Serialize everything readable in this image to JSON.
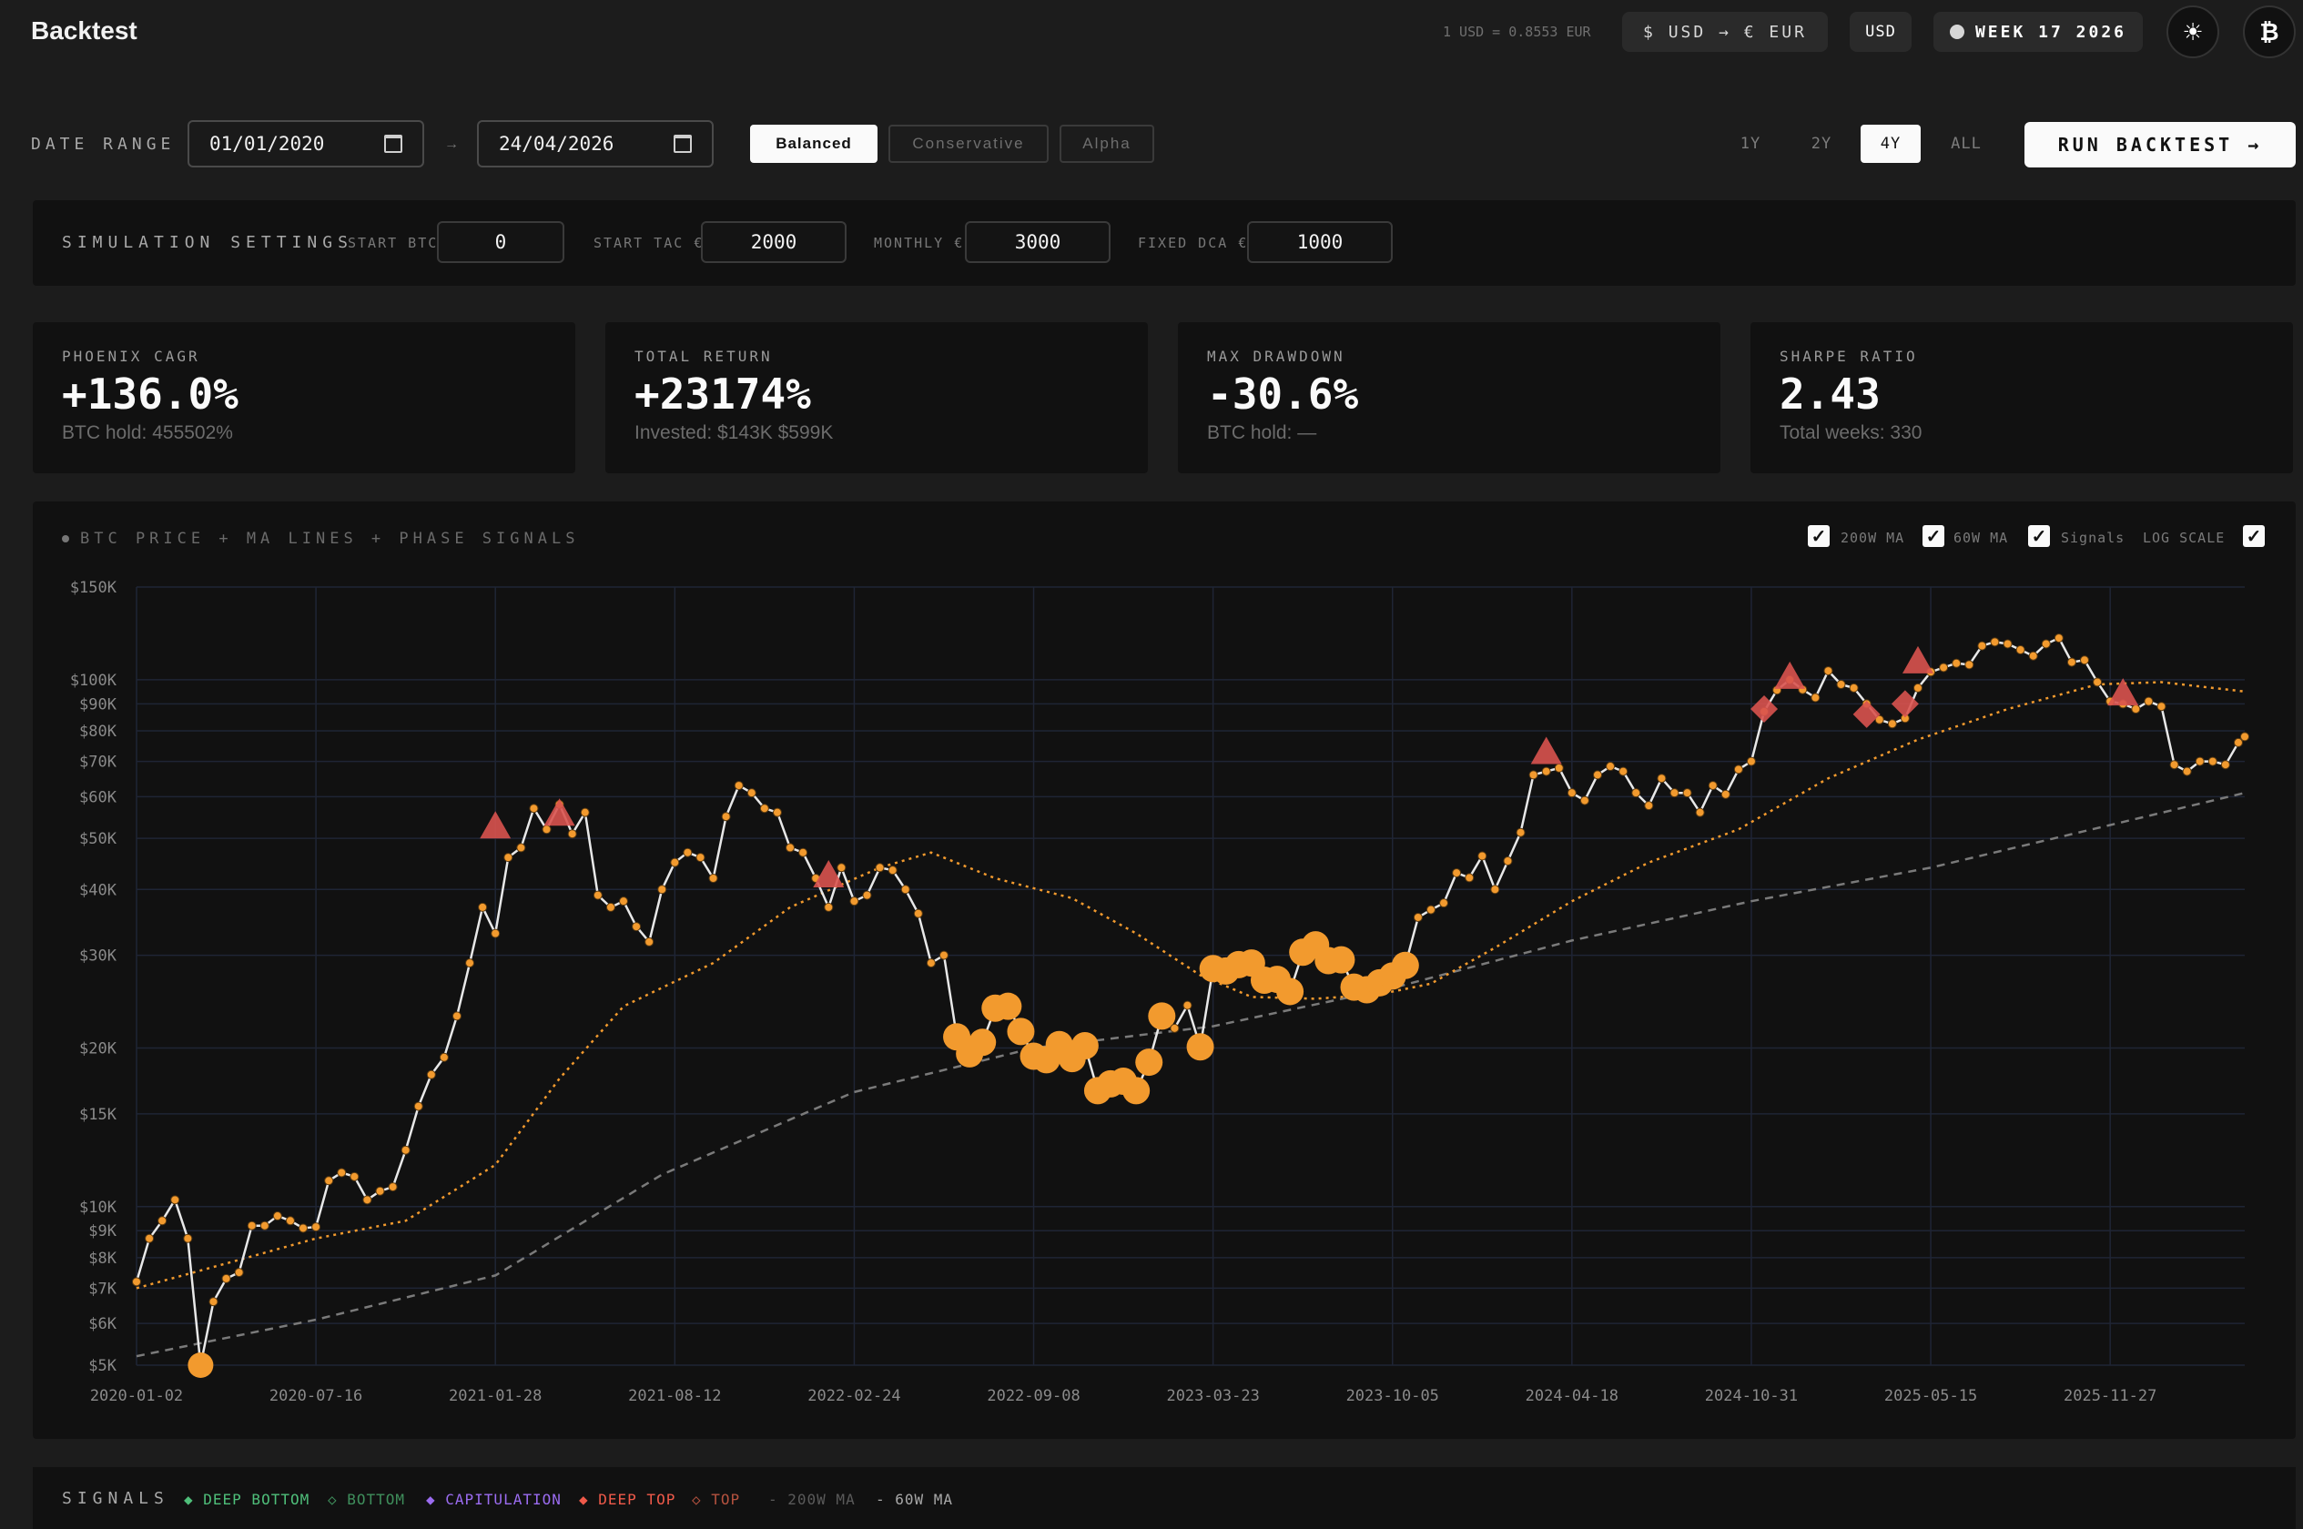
{
  "header": {
    "title": "Backtest",
    "fx_rate": "1 USD = 0.8553 EUR",
    "convert_label": "$ USD → € EUR",
    "currency": "USD",
    "week": "WEEK 17 2026",
    "theme_icon": "sun-icon",
    "brand_icon": "bitcoin-icon"
  },
  "date_range": {
    "label": "DATE RANGE",
    "from": "01/01/2020",
    "separator": "→",
    "to": "24/04/2026"
  },
  "strategies": {
    "selected": "Balanced",
    "items": [
      "Balanced",
      "Conservative",
      "Alpha"
    ]
  },
  "periods": {
    "selected": "4Y",
    "items": [
      "1Y",
      "2Y",
      "4Y",
      "ALL"
    ]
  },
  "run_button": "RUN BACKTEST →",
  "simulation": {
    "title": "SIMULATION SETTINGS",
    "start_btc_label": "START BTC",
    "start_btc": "0",
    "start_tac_label": "START TAC €",
    "start_tac": "2000",
    "monthly_label": "MONTHLY €",
    "monthly": "3000",
    "fixed_dca_label": "FIXED DCA €",
    "fixed_dca": "1000"
  },
  "stats": [
    {
      "label": "PHOENIX CAGR",
      "value": "+136.0%",
      "sub": "BTC hold: 455502%"
    },
    {
      "label": "TOTAL RETURN",
      "value": "+23174%",
      "sub": "Invested: $143K $599K"
    },
    {
      "label": "MAX DRAWDOWN",
      "value": "-30.6%",
      "sub": "BTC hold: —"
    },
    {
      "label": "SHARPE RATIO",
      "value": "2.43",
      "sub": "Total weeks: 330"
    }
  ],
  "chart_panel": {
    "title": "BTC PRICE + MA LINES + PHASE SIGNALS",
    "toggles": {
      "ma200": "200W MA",
      "ma60": "60W MA",
      "signals": "Signals",
      "log_scale": "LOG SCALE"
    },
    "checked": {
      "ma200": true,
      "ma60": true,
      "signals": true,
      "log_scale": true
    }
  },
  "legend": {
    "title": "SIGNALS",
    "items": [
      {
        "label": "◆ DEEP BOTTOM",
        "color": "#4fbf7a"
      },
      {
        "label": "◇ BOTTOM",
        "color": "#3f8f5c"
      },
      {
        "label": "◆ CAPITULATION",
        "color": "#9b6cf0"
      },
      {
        "label": "◆ DEEP TOP",
        "color": "#f05a4a"
      },
      {
        "label": "◇ TOP",
        "color": "#b5523f"
      },
      {
        "label": "- 200W MA",
        "color": "#5a5a5a"
      },
      {
        "label": "- 60W MA",
        "color": "#a8a8a8"
      }
    ]
  },
  "colors": {
    "accent": "#f29a2e",
    "top_signal": "#d9534f",
    "price_line": "#e8e8e8",
    "ma200": "#7a7a7a",
    "ma60": "#f29a2e"
  },
  "chart_data": {
    "type": "line",
    "title": "BTC PRICE + MA LINES + PHASE SIGNALS",
    "y_scale": "log",
    "ylim": [
      5000,
      150000
    ],
    "y_ticks": [
      {
        "v": 150000,
        "label": "$150K"
      },
      {
        "v": 100000,
        "label": "$100K"
      },
      {
        "v": 90000,
        "label": "$90K"
      },
      {
        "v": 80000,
        "label": "$80K"
      },
      {
        "v": 70000,
        "label": "$70K"
      },
      {
        "v": 60000,
        "label": "$60K"
      },
      {
        "v": 50000,
        "label": "$50K"
      },
      {
        "v": 40000,
        "label": "$40K"
      },
      {
        "v": 30000,
        "label": "$30K"
      },
      {
        "v": 20000,
        "label": "$20K"
      },
      {
        "v": 15000,
        "label": "$15K"
      },
      {
        "v": 10000,
        "label": "$10K"
      },
      {
        "v": 9000,
        "label": "$9K"
      },
      {
        "v": 8000,
        "label": "$8K"
      },
      {
        "v": 7000,
        "label": "$7K"
      },
      {
        "v": 6000,
        "label": "$6K"
      },
      {
        "v": 5000,
        "label": "$5K"
      }
    ],
    "x_ticks": [
      "2020-01-02",
      "2020-07-16",
      "2021-01-28",
      "2021-08-12",
      "2022-02-24",
      "2022-09-08",
      "2023-03-23",
      "2023-10-05",
      "2024-04-18",
      "2024-10-31",
      "2025-05-15",
      "2025-11-27"
    ],
    "xlim": [
      "2020-01-02",
      "2026-04-23"
    ],
    "grid": true,
    "series": [
      {
        "name": "BTC price",
        "points": [
          [
            "2020-01-02",
            7200
          ],
          [
            "2020-01-16",
            8700
          ],
          [
            "2020-01-30",
            9400
          ],
          [
            "2020-02-13",
            10300
          ],
          [
            "2020-02-27",
            8700
          ],
          [
            "2020-03-12",
            5000
          ],
          [
            "2020-03-26",
            6600
          ],
          [
            "2020-04-09",
            7300
          ],
          [
            "2020-04-23",
            7500
          ],
          [
            "2020-05-07",
            9200
          ],
          [
            "2020-05-21",
            9200
          ],
          [
            "2020-06-04",
            9600
          ],
          [
            "2020-06-18",
            9400
          ],
          [
            "2020-07-02",
            9100
          ],
          [
            "2020-07-16",
            9150
          ],
          [
            "2020-07-30",
            11200
          ],
          [
            "2020-08-13",
            11600
          ],
          [
            "2020-08-27",
            11400
          ],
          [
            "2020-09-10",
            10300
          ],
          [
            "2020-09-24",
            10700
          ],
          [
            "2020-10-08",
            10900
          ],
          [
            "2020-10-22",
            12800
          ],
          [
            "2020-11-05",
            15500
          ],
          [
            "2020-11-19",
            17800
          ],
          [
            "2020-12-03",
            19200
          ],
          [
            "2020-12-17",
            23000
          ],
          [
            "2020-12-31",
            29000
          ],
          [
            "2021-01-14",
            37000
          ],
          [
            "2021-01-28",
            33000
          ],
          [
            "2021-02-11",
            46000
          ],
          [
            "2021-02-25",
            48000
          ],
          [
            "2021-03-11",
            57000
          ],
          [
            "2021-03-25",
            52000
          ],
          [
            "2021-04-08",
            58000
          ],
          [
            "2021-04-22",
            51000
          ],
          [
            "2021-05-06",
            56000
          ],
          [
            "2021-05-20",
            39000
          ],
          [
            "2021-06-03",
            37000
          ],
          [
            "2021-06-17",
            38000
          ],
          [
            "2021-07-01",
            34000
          ],
          [
            "2021-07-15",
            31800
          ],
          [
            "2021-07-29",
            40000
          ],
          [
            "2021-08-12",
            45000
          ],
          [
            "2021-08-26",
            47000
          ],
          [
            "2021-09-09",
            46000
          ],
          [
            "2021-09-23",
            42000
          ],
          [
            "2021-10-07",
            55000
          ],
          [
            "2021-10-21",
            63000
          ],
          [
            "2021-11-04",
            61000
          ],
          [
            "2021-11-18",
            57000
          ],
          [
            "2021-12-02",
            56000
          ],
          [
            "2021-12-16",
            48000
          ],
          [
            "2021-12-30",
            47000
          ],
          [
            "2022-01-13",
            42000
          ],
          [
            "2022-01-27",
            37000
          ],
          [
            "2022-02-10",
            44000
          ],
          [
            "2022-02-24",
            38000
          ],
          [
            "2022-03-10",
            39000
          ],
          [
            "2022-03-24",
            44000
          ],
          [
            "2022-04-07",
            43500
          ],
          [
            "2022-04-21",
            40000
          ],
          [
            "2022-05-05",
            36000
          ],
          [
            "2022-05-19",
            29000
          ],
          [
            "2022-06-02",
            30000
          ],
          [
            "2022-06-16",
            21000
          ],
          [
            "2022-06-30",
            19500
          ],
          [
            "2022-07-14",
            20500
          ],
          [
            "2022-07-28",
            23800
          ],
          [
            "2022-08-11",
            24000
          ],
          [
            "2022-08-25",
            21500
          ],
          [
            "2022-09-08",
            19300
          ],
          [
            "2022-09-22",
            19000
          ],
          [
            "2022-10-06",
            20300
          ],
          [
            "2022-10-20",
            19100
          ],
          [
            "2022-11-03",
            20200
          ],
          [
            "2022-11-17",
            16600
          ],
          [
            "2022-12-01",
            17100
          ],
          [
            "2022-12-15",
            17300
          ],
          [
            "2022-12-29",
            16600
          ],
          [
            "2023-01-12",
            18800
          ],
          [
            "2023-01-26",
            23000
          ],
          [
            "2023-02-09",
            21800
          ],
          [
            "2023-02-23",
            24100
          ],
          [
            "2023-03-09",
            20100
          ],
          [
            "2023-03-23",
            28300
          ],
          [
            "2023-04-06",
            28000
          ],
          [
            "2023-04-20",
            28800
          ],
          [
            "2023-05-04",
            29000
          ],
          [
            "2023-05-18",
            26900
          ],
          [
            "2023-06-01",
            27000
          ],
          [
            "2023-06-15",
            25600
          ],
          [
            "2023-06-29",
            30400
          ],
          [
            "2023-07-13",
            31400
          ],
          [
            "2023-07-27",
            29300
          ],
          [
            "2023-08-10",
            29400
          ],
          [
            "2023-08-24",
            26100
          ],
          [
            "2023-09-07",
            25800
          ],
          [
            "2023-09-21",
            26600
          ],
          [
            "2023-10-05",
            27400
          ],
          [
            "2023-10-19",
            28700
          ],
          [
            "2023-11-02",
            35400
          ],
          [
            "2023-11-16",
            36600
          ],
          [
            "2023-11-30",
            37700
          ],
          [
            "2023-12-14",
            43000
          ],
          [
            "2023-12-28",
            42100
          ],
          [
            "2024-01-11",
            46300
          ],
          [
            "2024-01-25",
            40000
          ],
          [
            "2024-02-08",
            45300
          ],
          [
            "2024-02-22",
            51300
          ],
          [
            "2024-03-07",
            66000
          ],
          [
            "2024-03-21",
            67000
          ],
          [
            "2024-04-04",
            68000
          ],
          [
            "2024-04-18",
            61000
          ],
          [
            "2024-05-02",
            59000
          ],
          [
            "2024-05-16",
            66000
          ],
          [
            "2024-05-30",
            68500
          ],
          [
            "2024-06-13",
            67000
          ],
          [
            "2024-06-27",
            61000
          ],
          [
            "2024-07-11",
            57700
          ],
          [
            "2024-07-25",
            65000
          ],
          [
            "2024-08-08",
            61000
          ],
          [
            "2024-08-22",
            61000
          ],
          [
            "2024-09-05",
            56000
          ],
          [
            "2024-09-19",
            63000
          ],
          [
            "2024-10-03",
            60600
          ],
          [
            "2024-10-17",
            67600
          ],
          [
            "2024-10-31",
            70000
          ],
          [
            "2024-11-14",
            87000
          ],
          [
            "2024-11-28",
            95600
          ],
          [
            "2024-12-12",
            100000
          ],
          [
            "2024-12-26",
            95800
          ],
          [
            "2025-01-09",
            92500
          ],
          [
            "2025-01-23",
            104000
          ],
          [
            "2025-02-06",
            98000
          ],
          [
            "2025-02-20",
            96500
          ],
          [
            "2025-03-06",
            90000
          ],
          [
            "2025-03-20",
            84000
          ],
          [
            "2025-04-03",
            82500
          ],
          [
            "2025-04-17",
            84500
          ],
          [
            "2025-05-01",
            96500
          ],
          [
            "2025-05-15",
            103500
          ],
          [
            "2025-05-29",
            105500
          ],
          [
            "2025-06-12",
            107500
          ],
          [
            "2025-06-26",
            106800
          ],
          [
            "2025-07-10",
            116000
          ],
          [
            "2025-07-24",
            118000
          ],
          [
            "2025-08-07",
            117000
          ],
          [
            "2025-08-21",
            114000
          ],
          [
            "2025-09-04",
            111000
          ],
          [
            "2025-09-18",
            117000
          ],
          [
            "2025-10-02",
            120000
          ],
          [
            "2025-10-16",
            108000
          ],
          [
            "2025-10-30",
            109000
          ],
          [
            "2025-11-13",
            99000
          ],
          [
            "2025-11-27",
            91000
          ],
          [
            "2025-12-11",
            90000
          ],
          [
            "2025-12-25",
            88000
          ],
          [
            "2026-01-08",
            91000
          ],
          [
            "2026-01-22",
            89000
          ],
          [
            "2026-02-05",
            69000
          ],
          [
            "2026-02-19",
            67000
          ],
          [
            "2026-03-05",
            70000
          ],
          [
            "2026-03-19",
            70000
          ],
          [
            "2026-04-02",
            69000
          ],
          [
            "2026-04-16",
            76000
          ],
          [
            "2026-04-23",
            78000
          ]
        ]
      },
      {
        "name": "60W MA",
        "points": [
          [
            "2020-01-02",
            7000
          ],
          [
            "2020-04-09",
            7800
          ],
          [
            "2020-07-16",
            8700
          ],
          [
            "2020-10-22",
            9400
          ],
          [
            "2021-01-28",
            12000
          ],
          [
            "2021-04-08",
            17500
          ],
          [
            "2021-06-17",
            24000
          ],
          [
            "2021-09-23",
            29000
          ],
          [
            "2021-12-16",
            37000
          ],
          [
            "2022-03-24",
            44000
          ],
          [
            "2022-05-19",
            47000
          ],
          [
            "2022-07-28",
            42000
          ],
          [
            "2022-10-20",
            38500
          ],
          [
            "2022-12-29",
            33000
          ],
          [
            "2023-03-09",
            27500
          ],
          [
            "2023-05-04",
            25000
          ],
          [
            "2023-07-13",
            24800
          ],
          [
            "2023-09-21",
            25300
          ],
          [
            "2023-11-16",
            26500
          ],
          [
            "2024-01-25",
            31000
          ],
          [
            "2024-04-18",
            38000
          ],
          [
            "2024-07-11",
            45000
          ],
          [
            "2024-10-17",
            52000
          ],
          [
            "2025-01-23",
            65000
          ],
          [
            "2025-05-01",
            77000
          ],
          [
            "2025-08-07",
            88000
          ],
          [
            "2025-11-13",
            98000
          ],
          [
            "2026-01-22",
            99000
          ],
          [
            "2026-04-23",
            95000
          ]
        ]
      },
      {
        "name": "200W MA",
        "points": [
          [
            "2020-01-02",
            5200
          ],
          [
            "2020-07-16",
            6100
          ],
          [
            "2021-01-28",
            7400
          ],
          [
            "2021-07-29",
            11500
          ],
          [
            "2022-02-24",
            16500
          ],
          [
            "2022-09-08",
            20000
          ],
          [
            "2023-03-23",
            22000
          ],
          [
            "2023-10-05",
            26000
          ],
          [
            "2024-04-18",
            32000
          ],
          [
            "2024-10-31",
            38000
          ],
          [
            "2025-05-15",
            44000
          ],
          [
            "2025-11-27",
            53000
          ],
          [
            "2026-04-23",
            61000
          ]
        ]
      }
    ],
    "signals": [
      {
        "date": "2020-03-12",
        "price": 5000,
        "type": "bottom-large"
      },
      {
        "date": "2021-01-28",
        "price": 52000,
        "type": "deep-top"
      },
      {
        "date": "2021-04-08",
        "price": 55000,
        "type": "deep-top"
      },
      {
        "date": "2022-01-27",
        "price": 42000,
        "type": "deep-top"
      },
      {
        "date": "2024-03-21",
        "price": 72000,
        "type": "deep-top"
      },
      {
        "date": "2024-11-14",
        "price": 88000,
        "type": "top"
      },
      {
        "date": "2024-12-12",
        "price": 100000,
        "type": "deep-top"
      },
      {
        "date": "2025-03-06",
        "price": 86000,
        "type": "top"
      },
      {
        "date": "2025-04-17",
        "price": 90000,
        "type": "top"
      },
      {
        "date": "2025-05-01",
        "price": 107000,
        "type": "deep-top"
      },
      {
        "date": "2025-12-11",
        "price": 93000,
        "type": "deep-top"
      }
    ],
    "accumulation_ranges": [
      [
        "2022-06-16",
        "2023-01-26"
      ],
      [
        "2023-03-09",
        "2023-10-19"
      ]
    ]
  }
}
